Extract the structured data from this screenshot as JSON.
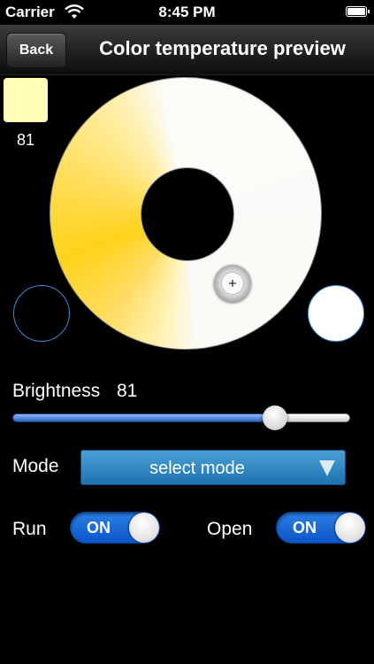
{
  "status_bar": {
    "carrier": "Carrier",
    "time": "8:45 PM"
  },
  "nav": {
    "back_label": "Back",
    "title": "Color temperature preview"
  },
  "swatch": {
    "color": "#ffffb8",
    "value": "81"
  },
  "wheel": {
    "warm_color": "#ffd21a",
    "cool_color": "#fbfbf8"
  },
  "brightness": {
    "label": "Brightness",
    "value": "81",
    "slider_fraction": 0.8
  },
  "mode": {
    "label": "Mode",
    "selected": "select mode"
  },
  "switches": {
    "run": {
      "label": "Run",
      "state": "ON"
    },
    "open": {
      "label": "Open",
      "state": "ON"
    }
  },
  "colors": {
    "accent": "#2b7fe6",
    "ring_border": "#3d8ae0",
    "mode_button": "#1e73b0"
  }
}
